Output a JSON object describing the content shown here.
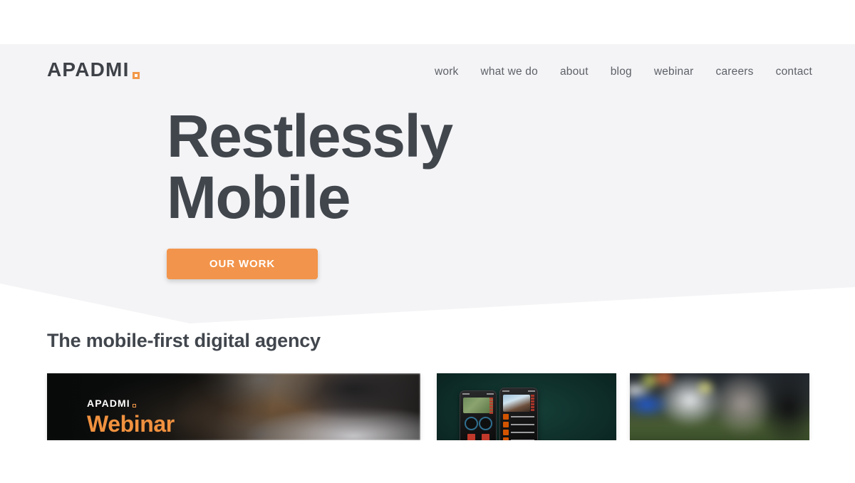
{
  "site": {
    "logo_text": "APADMI",
    "logo_mark": "orange-square-icon",
    "accent_color": "#f2944b",
    "hero_bg_color": "#f4f4f6",
    "text_color": "#41464d"
  },
  "nav": {
    "items": [
      {
        "label": "work"
      },
      {
        "label": "what we do"
      },
      {
        "label": "about"
      },
      {
        "label": "blog"
      },
      {
        "label": "webinar"
      },
      {
        "label": "careers"
      },
      {
        "label": "contact"
      }
    ]
  },
  "hero": {
    "title_line1": "Restlessly",
    "title_line2": "Mobile",
    "cta_label": "OUR WORK"
  },
  "section": {
    "heading": "The mobile-first digital agency",
    "cards": [
      {
        "name": "webinar-card",
        "brand": "APADMI",
        "title": "Webinar",
        "image_desc": "blurred photo of hands holding a tablet over a wooden desk with a laptop"
      },
      {
        "name": "app-showcase-card",
        "image_desc": "two smartphone mockups on a dark teal background showing a map with gauges and a video feed list"
      },
      {
        "name": "sports-card",
        "image_desc": "blurred stadium scene with green pitch and blue advertising hoardings"
      }
    ]
  }
}
